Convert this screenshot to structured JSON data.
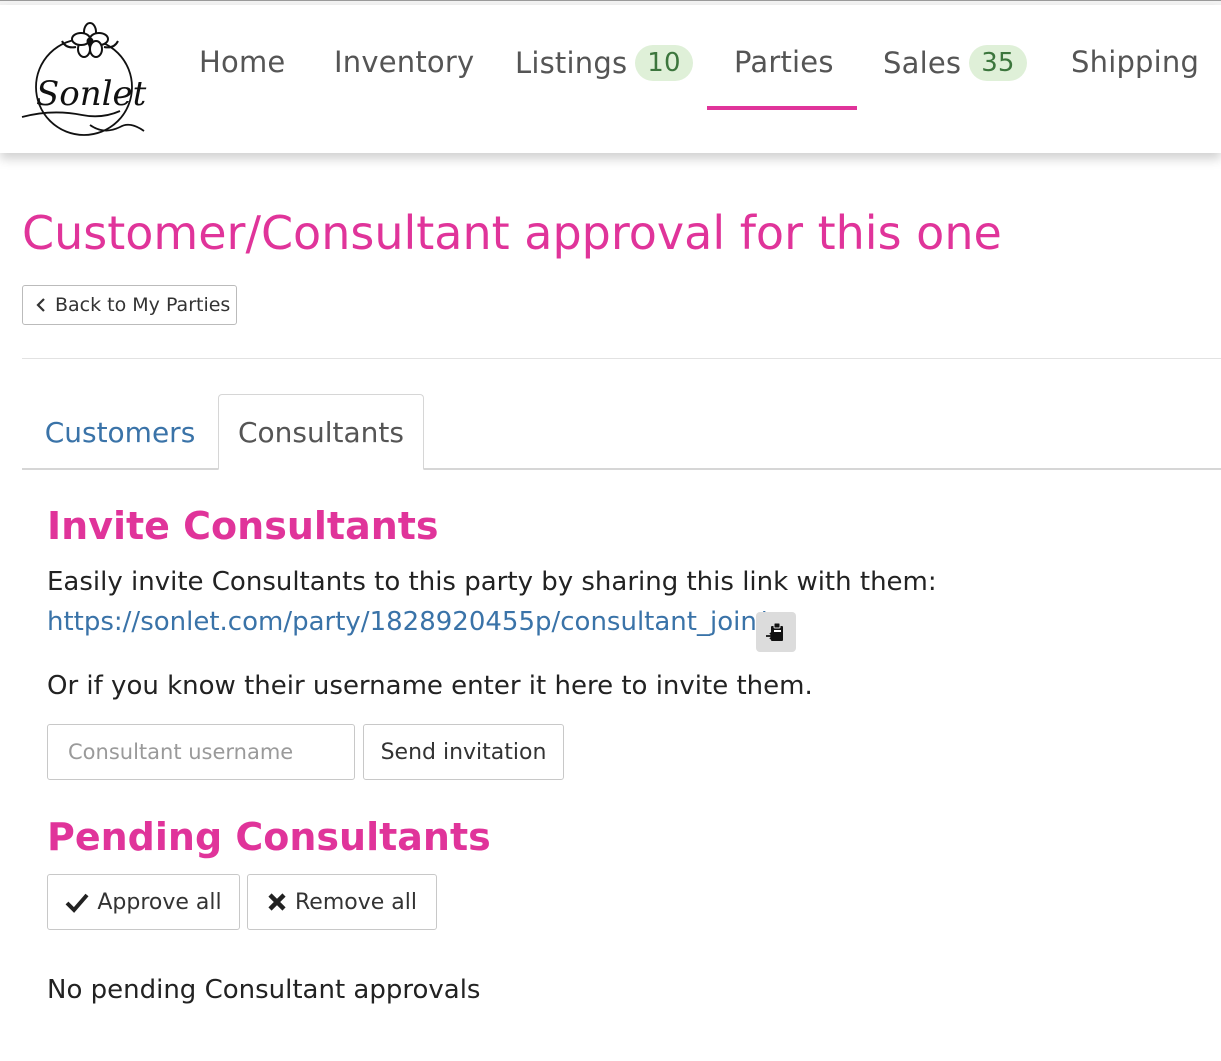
{
  "brand": {
    "logo_text": "Sonlet",
    "accent": "#e0349a",
    "link_color": "#3a73a8",
    "badge_bg": "#dff0d8",
    "badge_fg": "#3c763d"
  },
  "nav": {
    "items": [
      {
        "label": "Home"
      },
      {
        "label": "Inventory"
      },
      {
        "label": "Listings",
        "badge": "10"
      },
      {
        "label": "Parties",
        "active": true
      },
      {
        "label": "Sales",
        "badge": "35"
      },
      {
        "label": "Shipping"
      }
    ]
  },
  "page": {
    "title": "Customer/Consultant approval for this one",
    "back_label": "Back to My Parties"
  },
  "tabs": [
    {
      "label": "Customers"
    },
    {
      "label": "Consultants",
      "active": true
    }
  ],
  "invite": {
    "heading": "Invite Consultants",
    "intro": "Easily invite Consultants to this party by sharing this link with them:",
    "link": "https://sonlet.com/party/1828920455p/consultant_join/",
    "copy_icon": "clipboard-icon",
    "username_prompt": "Or if you know their username enter it here to invite them.",
    "input_placeholder": "Consultant username",
    "input_value": "",
    "send_label": "Send invitation"
  },
  "pending": {
    "heading": "Pending Consultants",
    "approve_label": "Approve all",
    "remove_label": "Remove all",
    "empty_text": "No pending Consultant approvals"
  }
}
